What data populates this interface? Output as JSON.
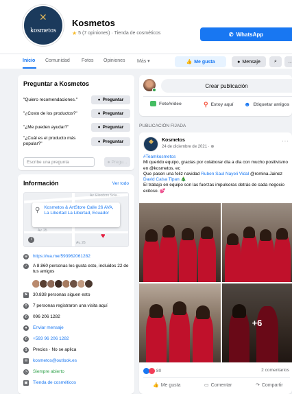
{
  "header": {
    "logo_text": "kosmetos",
    "page_name": "Kosmetos",
    "rating": "5 (7 opiniones) · Tienda de cosméticos",
    "whatsapp_label": "WhatsApp"
  },
  "nav": {
    "tabs": [
      "Inicio",
      "Comunidad",
      "Fotos",
      "Opiniones",
      "Más ▾"
    ],
    "like_label": "Me gusta",
    "message_label": "Mensaje"
  },
  "ask": {
    "title": "Preguntar a Kosmetos",
    "questions": [
      "\"Quiero recomendaciones.\"",
      "\"¿Costo de los productos?\"",
      "\"¿Me pueden ayudar?\"",
      "\"¿Cuál es el producto más popular?\""
    ],
    "ask_label": "Preguntar",
    "input_placeholder": "Escribe una pregunta",
    "send_label": "Pregu..."
  },
  "info": {
    "title": "Información",
    "see_all": "Ver todo",
    "address": "Kosmetos & ArtStore Calle 26 AVA, La Libertad La Libertad, Ecuador",
    "map_street_1": "Av. Eleodoro Sola...",
    "map_street_2": "Av. 25",
    "map_street_3": "Av. 26",
    "rows": {
      "website": "https://wa.me/593962061282",
      "likes": "A 8.860 personas les gusta esto, incluidos 22 de tus amigos",
      "followers": "30.838 personas siguen esto",
      "checkins": "7 personas registraron una visita aquí",
      "phone": "096 206 1282",
      "send_message": "Enviar mensaje",
      "whatsapp": "+593 96 206 1282",
      "price": "Precios · No se aplica",
      "email": "kosmetos@outlook.es",
      "hours": "Siempre abierto",
      "category": "Tienda de cosméticos"
    }
  },
  "composer": {
    "placeholder": "Crear publicación",
    "photo_label": "Foto/video",
    "location_label": "Estoy aquí",
    "tag_label": "Etiquetar amigos"
  },
  "post": {
    "pinned_label": "PUBLICACIÓN FIJADA",
    "author": "Kosmetos",
    "date": "24 de diciembre de 2021 · ",
    "hashtag": "#Teamkosmetos",
    "body_1": "Mi querido equipo, gracias por colaborar día a día con mucho positivismo en @kosmetos. ec",
    "body_2_prefix": "Que pasen una feliz navidad ",
    "body_2_link1": "Ruben Saul Nayeli Vidal",
    "body_2_mid": " @romina.Jainez ",
    "body_2_link2": "David Caisa Tipan",
    "body_2_suffix": " 🎄",
    "body_3": "El trabajo en equipo son las fuerzas impulsoras detrás de cada negocio exitoso. 💕",
    "more_photos": "+6",
    "reaction_count": "80",
    "comment_count": "2 comentarios",
    "like_action": "Me gusta",
    "comment_action": "Comentar",
    "share_action": "Compartir"
  },
  "colors": {
    "brand": "#1877f2",
    "logo_bg": "#1b3a5c",
    "dress_red": "#c0112b"
  }
}
